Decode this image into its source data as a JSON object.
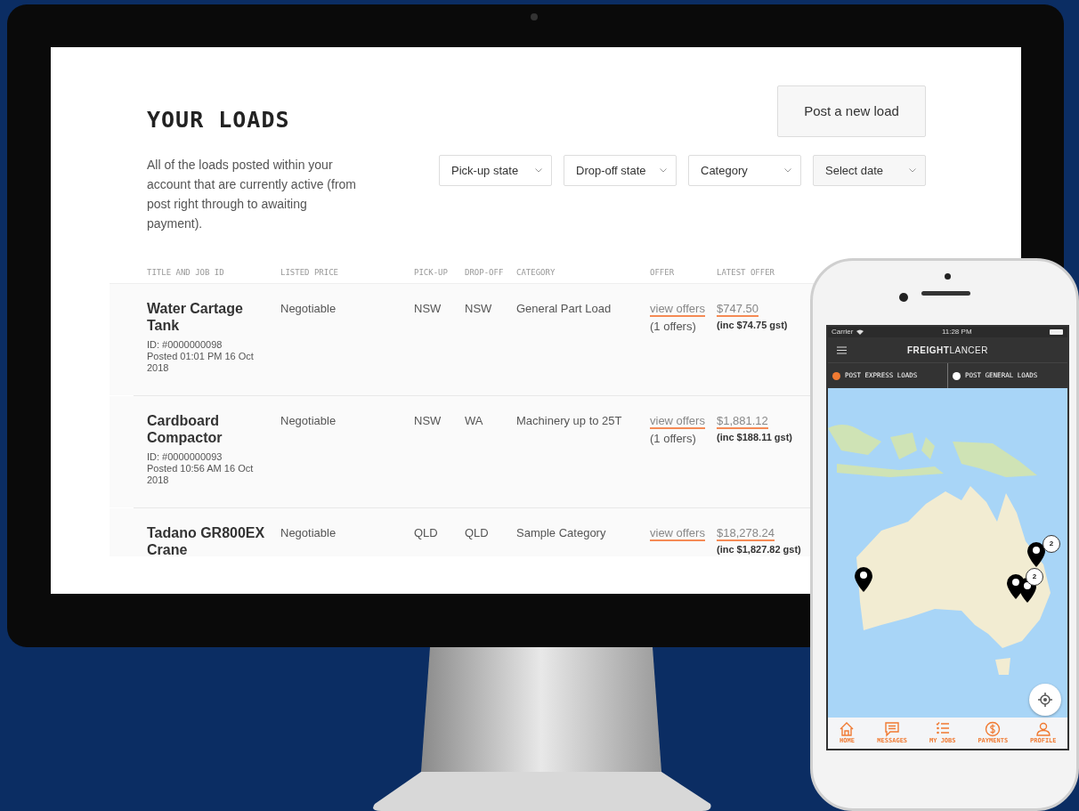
{
  "desktop": {
    "title": "YOUR LOADS",
    "post_button": "Post a new load",
    "description": "All of the loads posted within your account that are currently active (from post right through to awaiting payment).",
    "filters": [
      {
        "label": "Pick-up state"
      },
      {
        "label": "Drop-off state"
      },
      {
        "label": "Category"
      },
      {
        "label": "Select date"
      }
    ],
    "table": {
      "columns": [
        "TITLE AND JOB ID",
        "LISTED PRICE",
        "PICK-UP",
        "DROP-OFF",
        "CATEGORY",
        "OFFER",
        "LATEST OFFER"
      ],
      "rows": [
        {
          "title": "Water Cartage Tank",
          "job_id": "ID: #0000000098",
          "posted": "Posted 01:01 PM 16 Oct 2018",
          "listed_price": "Negotiable",
          "pick_up": "NSW",
          "drop_off": "NSW",
          "category": "General Part Load",
          "offer_link": "view offers",
          "offer_count": "(1 offers)",
          "latest_offer": "$747.50",
          "gst": "(inc $74.75 gst)"
        },
        {
          "title": "Cardboard Compactor",
          "job_id": "ID: #0000000093",
          "posted": "Posted 10:56 AM 16 Oct 2018",
          "listed_price": "Negotiable",
          "pick_up": "NSW",
          "drop_off": "WA",
          "category": "Machinery up to 25T",
          "offer_link": "view offers",
          "offer_count": "(1 offers)",
          "latest_offer": "$1,881.12",
          "gst": "(inc $188.11 gst)"
        },
        {
          "title": "Tadano GR800EX Crane",
          "listed_price": "Negotiable",
          "pick_up": "QLD",
          "drop_off": "QLD",
          "category": "Sample Category",
          "offer_link": "view offers",
          "latest_offer": "$18,278.24",
          "gst": "(inc $1,827.82 gst)"
        }
      ]
    }
  },
  "phone": {
    "status_bar": {
      "carrier": "Carrier",
      "time": "11:28 PM"
    },
    "app_title": "**FREIGHT**LANCER",
    "tabs": [
      {
        "label": "POST EXPRESS LOADS",
        "selected": true
      },
      {
        "label": "POST GENERAL LOADS",
        "selected": false
      }
    ],
    "map": {
      "cluster_badges": [
        "2",
        "2"
      ]
    },
    "bottom_nav": [
      {
        "label": "HOME"
      },
      {
        "label": "MESSAGES"
      },
      {
        "label": "MY JOBS"
      },
      {
        "label": "PAYMENTS"
      },
      {
        "label": "PROFILE"
      }
    ]
  }
}
